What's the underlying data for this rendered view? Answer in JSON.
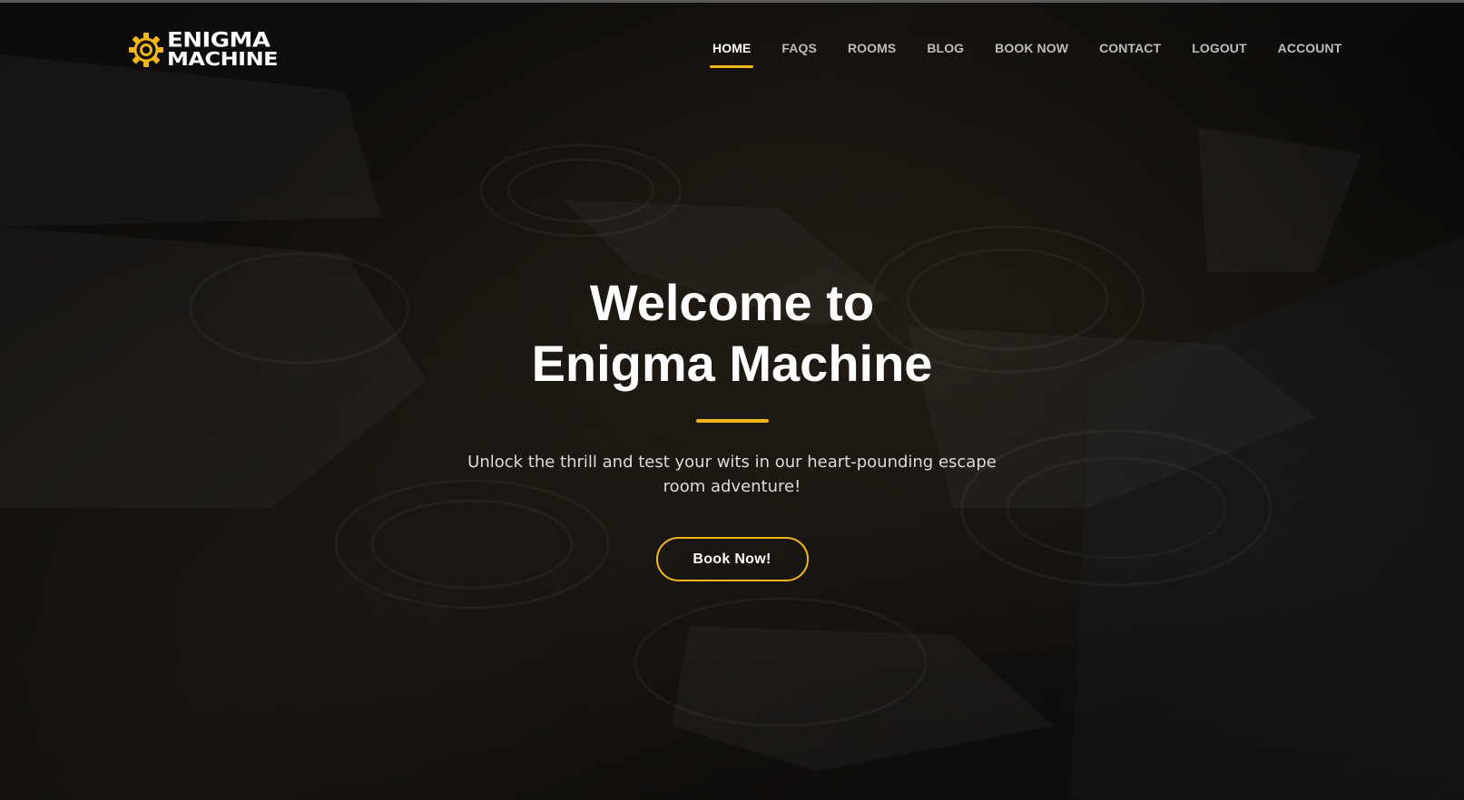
{
  "brand": {
    "name_line1": "ENIGMA",
    "name_line2": "MACHINE",
    "accent_color": "#f2b619",
    "icon": "gear-icon"
  },
  "nav": {
    "items": [
      {
        "label": "HOME",
        "active": true
      },
      {
        "label": "FAQS",
        "active": false
      },
      {
        "label": "ROOMS",
        "active": false
      },
      {
        "label": "BLOG",
        "active": false
      },
      {
        "label": "BOOK NOW",
        "active": false
      },
      {
        "label": "CONTACT",
        "active": false
      },
      {
        "label": "LOGOUT",
        "active": false
      },
      {
        "label": "ACCOUNT",
        "active": false
      }
    ]
  },
  "hero": {
    "title_line1": "Welcome to",
    "title_line2": "Enigma Machine",
    "subtitle": "Unlock the thrill and test your wits in our heart-pounding escape room adventure!",
    "cta_label": "Book Now!"
  }
}
